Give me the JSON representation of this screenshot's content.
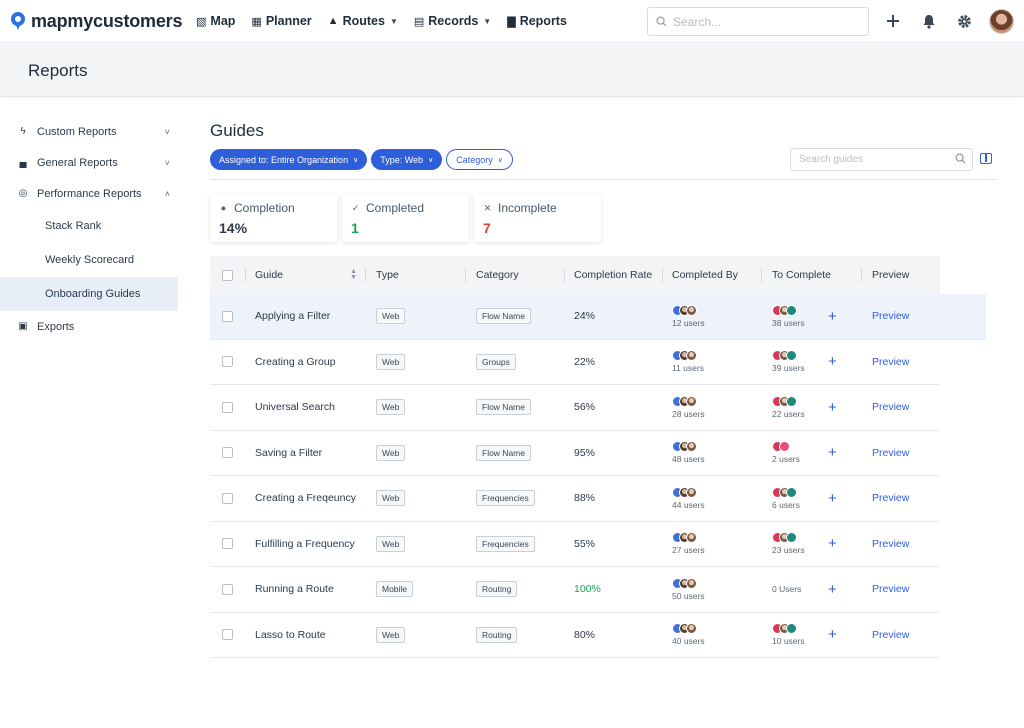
{
  "brand": {
    "name": "mapmycustomers",
    "accent": "#2f5fd8"
  },
  "nav": [
    {
      "label": "Map",
      "icon": "map-icon",
      "caret": false
    },
    {
      "label": "Planner",
      "icon": "calendar-icon",
      "caret": false
    },
    {
      "label": "Routes",
      "icon": "route-icon",
      "caret": true
    },
    {
      "label": "Records",
      "icon": "records-icon",
      "caret": true
    },
    {
      "label": "Reports",
      "icon": "bar-chart-icon",
      "caret": false
    }
  ],
  "topbar": {
    "search_placeholder": "Search..."
  },
  "page": {
    "title": "Reports"
  },
  "sidebar": {
    "items": [
      {
        "label": "Custom Reports",
        "icon": "lightning-icon",
        "expanded": false
      },
      {
        "label": "General Reports",
        "icon": "chart-icon",
        "expanded": false
      },
      {
        "label": "Performance Reports",
        "icon": "medal-icon",
        "expanded": true
      }
    ],
    "sub_items": [
      "Stack Rank",
      "Weekly Scorecard",
      "Onboarding Guides"
    ],
    "exports": {
      "label": "Exports",
      "icon": "export-icon"
    }
  },
  "main": {
    "title": "Guides",
    "filters": [
      {
        "label": "Assigned to: Entire Organization",
        "style": "filled"
      },
      {
        "label": "Type: Web",
        "style": "filled"
      },
      {
        "label": "Category",
        "style": "outline"
      }
    ],
    "search_placeholder": "Search guides"
  },
  "stats": [
    {
      "label": "Completion",
      "value": "14%",
      "icon": "check-circle-icon",
      "color": "#2c3a4a"
    },
    {
      "label": "Completed",
      "value": "1",
      "icon": "check-icon",
      "color": "#1aa35c"
    },
    {
      "label": "Incomplete",
      "value": "7",
      "icon": "x-icon",
      "color": "#e0433a"
    }
  ],
  "table": {
    "headers": [
      "Guide",
      "Type",
      "Category",
      "Completion Rate",
      "Completed By",
      "To Complete",
      "Preview"
    ],
    "rows": [
      {
        "guide": "Applying a Filter",
        "type": "Web",
        "category": "Flow Name",
        "rate": "24%",
        "by": "12 users",
        "to": "38 users",
        "to_avatars": "trio",
        "preview": "Preview"
      },
      {
        "guide": "Creating a Group",
        "type": "Web",
        "category": "Groups",
        "rate": "22%",
        "by": "11 users",
        "to": "39 users",
        "to_avatars": "trio",
        "preview": "Preview"
      },
      {
        "guide": "Universal Search",
        "type": "Web",
        "category": "Flow Name",
        "rate": "56%",
        "by": "28 users",
        "to": "22 users",
        "to_avatars": "trio",
        "preview": "Preview"
      },
      {
        "guide": "Saving a Filter",
        "type": "Web",
        "category": "Flow Name",
        "rate": "95%",
        "by": "48 users",
        "to": "2 users",
        "to_avatars": "duo",
        "preview": "Preview"
      },
      {
        "guide": "Creating a Freqeuncy",
        "type": "Web",
        "category": "Frequencies",
        "rate": "88%",
        "by": "44 users",
        "to": "6 users",
        "to_avatars": "trio",
        "preview": "Preview"
      },
      {
        "guide": "Fulfilling a Frequency",
        "type": "Web",
        "category": "Frequencies",
        "rate": "55%",
        "by": "27 users",
        "to": "23 users",
        "to_avatars": "trio",
        "preview": "Preview"
      },
      {
        "guide": "Running a Route",
        "type": "Mobile",
        "category": "Routing",
        "rate": "100%",
        "by": "50 users",
        "to": "0 Users",
        "to_avatars": "none",
        "preview": "Preview"
      },
      {
        "guide": "Lasso to Route",
        "type": "Web",
        "category": "Routing",
        "rate": "80%",
        "by": "40 users",
        "to": "10 users",
        "to_avatars": "trio",
        "preview": "Preview"
      }
    ]
  }
}
